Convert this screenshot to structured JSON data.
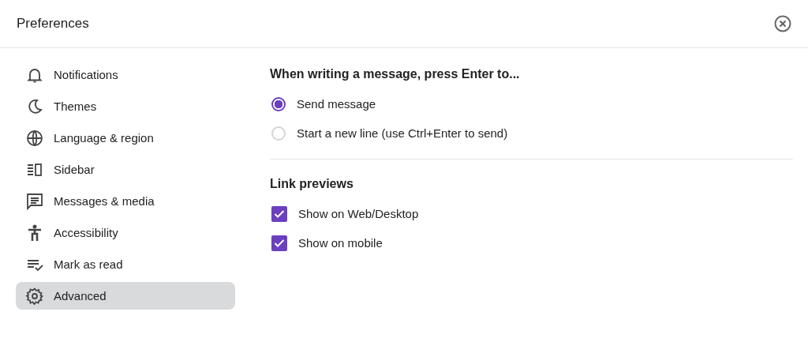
{
  "window": {
    "title": "Preferences"
  },
  "sidebar": {
    "items": [
      {
        "label": "Notifications",
        "selected": false
      },
      {
        "label": "Themes",
        "selected": false
      },
      {
        "label": "Language & region",
        "selected": false
      },
      {
        "label": "Sidebar",
        "selected": false
      },
      {
        "label": "Messages & media",
        "selected": false
      },
      {
        "label": "Accessibility",
        "selected": false
      },
      {
        "label": "Mark as read",
        "selected": false
      },
      {
        "label": "Advanced",
        "selected": true
      }
    ]
  },
  "sections": [
    {
      "title": "When writing a message, press Enter to...",
      "options": [
        {
          "kind": "radio",
          "label": "Send message",
          "checked": true
        },
        {
          "kind": "radio",
          "label": "Start a new line (use Ctrl+Enter to send)",
          "checked": false
        }
      ]
    },
    {
      "title": "Link previews",
      "options": [
        {
          "kind": "checkbox",
          "label": "Show on Web/Desktop",
          "checked": true
        },
        {
          "kind": "checkbox",
          "label": "Show on mobile",
          "checked": true
        }
      ]
    }
  ]
}
